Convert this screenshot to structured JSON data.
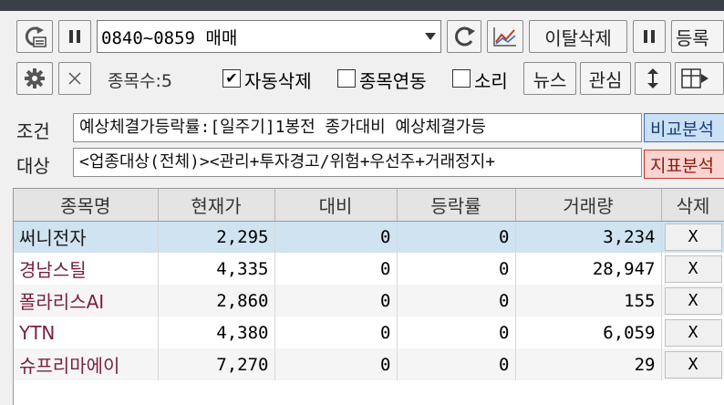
{
  "toolbar": {
    "condition_value": "0840~0859 매매",
    "deviation_delete_label": "이탈삭제",
    "register_label": "등록",
    "stock_count_label": "종목수:5",
    "auto_delete_label": "자동삭제",
    "auto_delete_checked": true,
    "link_label": "종목연동",
    "link_checked": false,
    "sound_label": "소리",
    "sound_checked": false,
    "news_label": "뉴스",
    "watch_label": "관심"
  },
  "condition": {
    "cond_label": "조건",
    "cond_value": "예상체결가등락률:[일주기]1봉전 종가대비 예상체결가등",
    "target_label": "대상",
    "target_value": "<업종대상(전체)><관리+투자경고/위험+우선주+거래정지+",
    "compare_label": "비교분석",
    "indicator_label": "지표분석"
  },
  "table": {
    "headers": [
      "종목명",
      "현재가",
      "대비",
      "등락률",
      "거래량",
      "삭제"
    ],
    "rows": [
      {
        "name": "써니전자",
        "price": "2,295",
        "diff": "0",
        "rate": "0",
        "volume": "3,234",
        "del": "X"
      },
      {
        "name": "경남스틸",
        "price": "4,335",
        "diff": "0",
        "rate": "0",
        "volume": "28,947",
        "del": "X"
      },
      {
        "name": "폴라리스AI",
        "price": "2,860",
        "diff": "0",
        "rate": "0",
        "volume": "155",
        "del": "X"
      },
      {
        "name": "YTN",
        "price": "4,380",
        "diff": "0",
        "rate": "0",
        "volume": "6,059",
        "del": "X"
      },
      {
        "name": "슈프리마에이",
        "price": "7,270",
        "diff": "0",
        "rate": "0",
        "volume": "29",
        "del": "X"
      }
    ]
  },
  "colors": {
    "selected_row": "#cfe3f1",
    "stock_name": "#7a1f3d",
    "compare_bg": "#c9e0f5",
    "indicator_bg": "#f9d4d0"
  },
  "icons": [
    "refresh-print-icon",
    "pause-icon",
    "dropdown-arrow-icon",
    "refresh-icon",
    "chart-icon",
    "pause-icon",
    "gear-icon",
    "close-icon",
    "updown-arrow-icon",
    "grid-export-icon"
  ]
}
